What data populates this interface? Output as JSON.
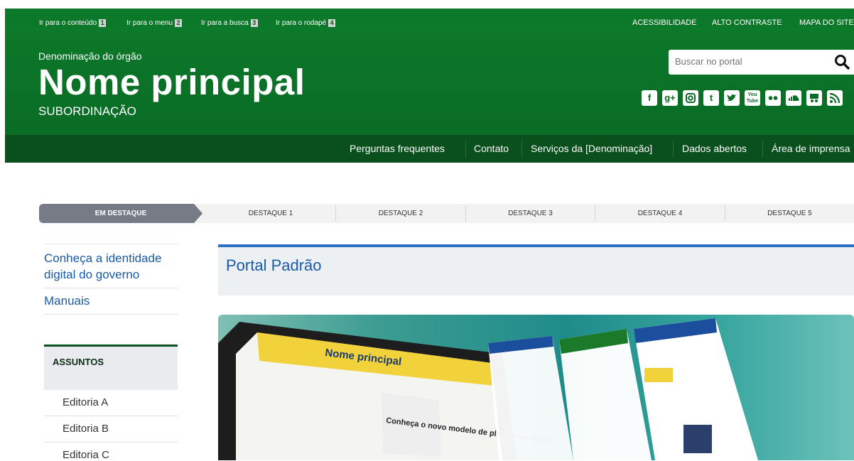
{
  "skip_links": [
    {
      "label": "Ir para o conteúdo",
      "num": "1"
    },
    {
      "label": "Ir para o menu",
      "num": "2"
    },
    {
      "label": "Ir para a busca",
      "num": "3"
    },
    {
      "label": "Ir para o rodapé",
      "num": "4"
    }
  ],
  "top_links": [
    "ACESSIBILIDADE",
    "ALTO CONTRASTE",
    "MAPA DO SITE"
  ],
  "header": {
    "org": "Denominação do órgão",
    "title": "Nome principal",
    "subordination": "SUBORDINAÇÃO"
  },
  "search": {
    "placeholder": "Buscar no portal"
  },
  "social_icons": [
    "facebook-icon",
    "google-plus-icon",
    "instagram-icon",
    "tumblr-icon",
    "twitter-icon",
    "youtube-icon",
    "flickr-icon",
    "soundcloud-icon",
    "slideshare-icon",
    "rss-icon"
  ],
  "nav": [
    "Perguntas frequentes",
    "Contato",
    "Serviços da [Denominação]",
    "Dados abertos",
    "Área de imprensa"
  ],
  "tabs": [
    "EM DESTAQUE",
    "DESTAQUE 1",
    "DESTAQUE 2",
    "DESTAQUE 3",
    "DESTAQUE 4",
    "DESTAQUE 5"
  ],
  "sidebar": {
    "links": [
      "Conheça a identidade digital do governo",
      "Manuais"
    ],
    "section_title": "ASSUNTOS",
    "editorias": [
      "Editoria A",
      "Editoria B",
      "Editoria C"
    ]
  },
  "main": {
    "title": "Portal Padrão"
  },
  "hero": {
    "screen_title": "Nome principal",
    "screen_text": "Conheça o novo modelo de plataforma digital"
  },
  "colors": {
    "header_green": "#0c7a2a",
    "nav_green": "#0a501d",
    "link_blue": "#1a5aa6",
    "tab_active": "#767b85"
  }
}
